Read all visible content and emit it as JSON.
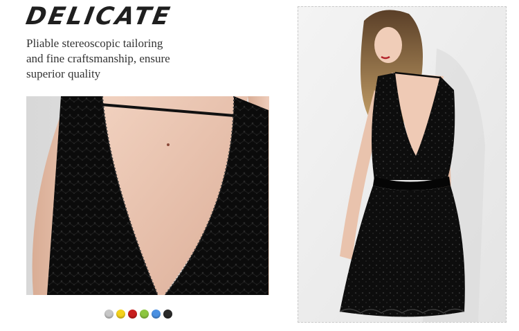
{
  "header": {
    "title": "DELICATE",
    "tagline_lines": [
      "Pliable stereoscopic tailoring",
      "and fine craftsmanship, ensure",
      "superior quality"
    ]
  },
  "colors": {
    "text_dark": "#1f1f1f",
    "dress": "#0d0d0d",
    "skin": "#e9c6b2"
  },
  "swatches": [
    {
      "name": "silver",
      "color": "#c7c7c7"
    },
    {
      "name": "yellow",
      "color": "#f4d21c"
    },
    {
      "name": "red",
      "color": "#c81e1e"
    },
    {
      "name": "green",
      "color": "#8cc63f"
    },
    {
      "name": "blue",
      "color": "#4a90e2"
    },
    {
      "name": "black",
      "color": "#2a2a2a"
    }
  ]
}
